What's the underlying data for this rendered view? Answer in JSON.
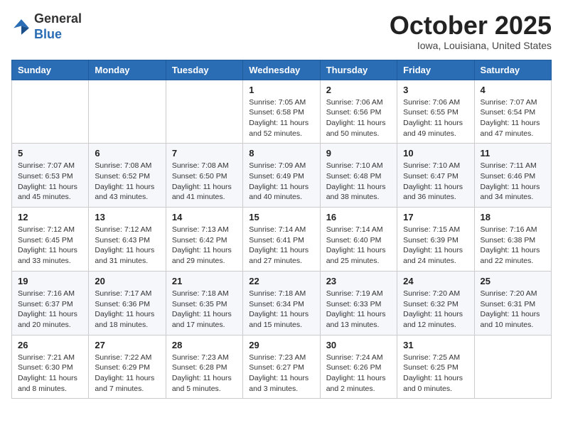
{
  "logo": {
    "general": "General",
    "blue": "Blue"
  },
  "header": {
    "month": "October 2025",
    "location": "Iowa, Louisiana, United States"
  },
  "days_of_week": [
    "Sunday",
    "Monday",
    "Tuesday",
    "Wednesday",
    "Thursday",
    "Friday",
    "Saturday"
  ],
  "weeks": [
    [
      {
        "day": "",
        "info": ""
      },
      {
        "day": "",
        "info": ""
      },
      {
        "day": "",
        "info": ""
      },
      {
        "day": "1",
        "info": "Sunrise: 7:05 AM\nSunset: 6:58 PM\nDaylight: 11 hours and 52 minutes."
      },
      {
        "day": "2",
        "info": "Sunrise: 7:06 AM\nSunset: 6:56 PM\nDaylight: 11 hours and 50 minutes."
      },
      {
        "day": "3",
        "info": "Sunrise: 7:06 AM\nSunset: 6:55 PM\nDaylight: 11 hours and 49 minutes."
      },
      {
        "day": "4",
        "info": "Sunrise: 7:07 AM\nSunset: 6:54 PM\nDaylight: 11 hours and 47 minutes."
      }
    ],
    [
      {
        "day": "5",
        "info": "Sunrise: 7:07 AM\nSunset: 6:53 PM\nDaylight: 11 hours and 45 minutes."
      },
      {
        "day": "6",
        "info": "Sunrise: 7:08 AM\nSunset: 6:52 PM\nDaylight: 11 hours and 43 minutes."
      },
      {
        "day": "7",
        "info": "Sunrise: 7:08 AM\nSunset: 6:50 PM\nDaylight: 11 hours and 41 minutes."
      },
      {
        "day": "8",
        "info": "Sunrise: 7:09 AM\nSunset: 6:49 PM\nDaylight: 11 hours and 40 minutes."
      },
      {
        "day": "9",
        "info": "Sunrise: 7:10 AM\nSunset: 6:48 PM\nDaylight: 11 hours and 38 minutes."
      },
      {
        "day": "10",
        "info": "Sunrise: 7:10 AM\nSunset: 6:47 PM\nDaylight: 11 hours and 36 minutes."
      },
      {
        "day": "11",
        "info": "Sunrise: 7:11 AM\nSunset: 6:46 PM\nDaylight: 11 hours and 34 minutes."
      }
    ],
    [
      {
        "day": "12",
        "info": "Sunrise: 7:12 AM\nSunset: 6:45 PM\nDaylight: 11 hours and 33 minutes."
      },
      {
        "day": "13",
        "info": "Sunrise: 7:12 AM\nSunset: 6:43 PM\nDaylight: 11 hours and 31 minutes."
      },
      {
        "day": "14",
        "info": "Sunrise: 7:13 AM\nSunset: 6:42 PM\nDaylight: 11 hours and 29 minutes."
      },
      {
        "day": "15",
        "info": "Sunrise: 7:14 AM\nSunset: 6:41 PM\nDaylight: 11 hours and 27 minutes."
      },
      {
        "day": "16",
        "info": "Sunrise: 7:14 AM\nSunset: 6:40 PM\nDaylight: 11 hours and 25 minutes."
      },
      {
        "day": "17",
        "info": "Sunrise: 7:15 AM\nSunset: 6:39 PM\nDaylight: 11 hours and 24 minutes."
      },
      {
        "day": "18",
        "info": "Sunrise: 7:16 AM\nSunset: 6:38 PM\nDaylight: 11 hours and 22 minutes."
      }
    ],
    [
      {
        "day": "19",
        "info": "Sunrise: 7:16 AM\nSunset: 6:37 PM\nDaylight: 11 hours and 20 minutes."
      },
      {
        "day": "20",
        "info": "Sunrise: 7:17 AM\nSunset: 6:36 PM\nDaylight: 11 hours and 18 minutes."
      },
      {
        "day": "21",
        "info": "Sunrise: 7:18 AM\nSunset: 6:35 PM\nDaylight: 11 hours and 17 minutes."
      },
      {
        "day": "22",
        "info": "Sunrise: 7:18 AM\nSunset: 6:34 PM\nDaylight: 11 hours and 15 minutes."
      },
      {
        "day": "23",
        "info": "Sunrise: 7:19 AM\nSunset: 6:33 PM\nDaylight: 11 hours and 13 minutes."
      },
      {
        "day": "24",
        "info": "Sunrise: 7:20 AM\nSunset: 6:32 PM\nDaylight: 11 hours and 12 minutes."
      },
      {
        "day": "25",
        "info": "Sunrise: 7:20 AM\nSunset: 6:31 PM\nDaylight: 11 hours and 10 minutes."
      }
    ],
    [
      {
        "day": "26",
        "info": "Sunrise: 7:21 AM\nSunset: 6:30 PM\nDaylight: 11 hours and 8 minutes."
      },
      {
        "day": "27",
        "info": "Sunrise: 7:22 AM\nSunset: 6:29 PM\nDaylight: 11 hours and 7 minutes."
      },
      {
        "day": "28",
        "info": "Sunrise: 7:23 AM\nSunset: 6:28 PM\nDaylight: 11 hours and 5 minutes."
      },
      {
        "day": "29",
        "info": "Sunrise: 7:23 AM\nSunset: 6:27 PM\nDaylight: 11 hours and 3 minutes."
      },
      {
        "day": "30",
        "info": "Sunrise: 7:24 AM\nSunset: 6:26 PM\nDaylight: 11 hours and 2 minutes."
      },
      {
        "day": "31",
        "info": "Sunrise: 7:25 AM\nSunset: 6:25 PM\nDaylight: 11 hours and 0 minutes."
      },
      {
        "day": "",
        "info": ""
      }
    ]
  ]
}
